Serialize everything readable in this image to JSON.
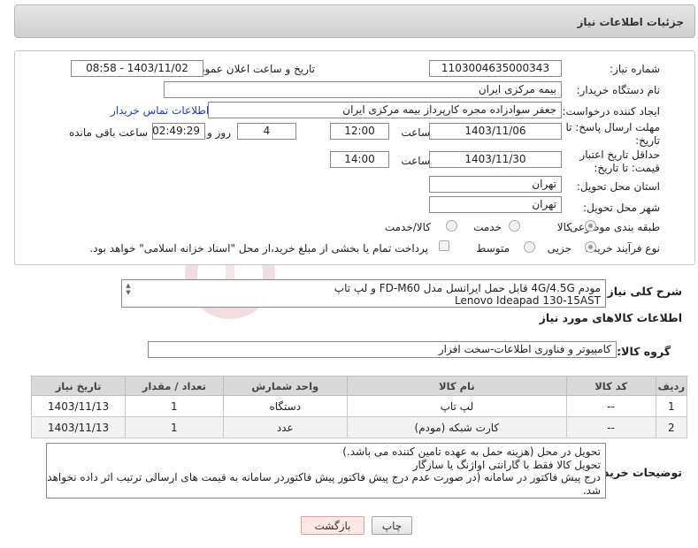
{
  "header": {
    "title": "جزئیات اطلاعات نیاز"
  },
  "form": {
    "need_number_label": "شماره نیاز:",
    "need_number": "1103004635000343",
    "announce_label": "تاریخ و ساعت اعلان عمومی:",
    "announce_value": "1403/11/02 - 08:58",
    "buyer_org_label": "نام دستگاه خریدار:",
    "buyer_org": "بیمه مرکزی ایران",
    "requester_label": "ایجاد کننده درخواست:",
    "requester": "جعفر سوادزاده مجره کارپرداز بیمه مرکزی ایران",
    "contact_link": "اطلاعات تماس خریدار",
    "reply_deadline_label": "مهلت ارسال پاسخ: تا تاریخ:",
    "reply_date": "1403/11/06",
    "time_label": "ساعت",
    "reply_time": "12:00",
    "days_value": "4",
    "days_label": "روز و",
    "remaining_time": "02:49:29",
    "remaining_label": "ساعت باقی مانده",
    "price_validity_label": "حداقل تاریخ اعتبار قیمت: تا تاریخ:",
    "price_date": "1403/11/30",
    "price_time_label": "ساعت",
    "price_time": "14:00",
    "province_label": "استان محل تحویل:",
    "province": "تهران",
    "city_label": "شهر محل تحویل:",
    "city": "تهران",
    "category_label": "طبقه بندی موضوعی:",
    "category_options": [
      "کالا",
      "خدمت",
      "کالا/خدمت"
    ],
    "process_label": "نوع فرآیند خرید :",
    "process_options": [
      "جزیی",
      "متوسط"
    ],
    "payment_note": "پرداخت تمام یا بخشی از مبلغ خرید،از محل \"اسناد خزانه اسلامی\" خواهد بود."
  },
  "summary": {
    "label": "شرح کلی نیاز:",
    "line1": "مودم 4G/4.5G قابل حمل ایرانسل مدل FD-M60 و لپ تاپ",
    "line2": "Lenovo Ideapad 130-15AST"
  },
  "goods": {
    "section_title": "اطلاعات کالاهای مورد نیاز",
    "group_label": "گروه کالا:",
    "group_value": "کامپیوتر و فناوری اطلاعات-سخت افزار"
  },
  "table": {
    "headers": [
      "ردیف",
      "کد کالا",
      "نام کالا",
      "واحد شمارش",
      "تعداد / مقدار",
      "تاریخ نیاز"
    ],
    "rows": [
      [
        "1",
        "--",
        "لپ تاپ",
        "دستگاه",
        "1",
        "1403/11/13"
      ],
      [
        "2",
        "--",
        "کارت شبکه (مودم)",
        "عدد",
        "1",
        "1403/11/13"
      ]
    ]
  },
  "buyer_notes": {
    "label": "توضیحات خریدار:",
    "line1": "تحویل در محل (هزینه حمل به عهده تامین کننده می باشد.)",
    "line2": "تحویل کالا فقط با گارانتی اواژنگ یا سازگار",
    "line3": "درج پیش فاکتور در سامانه (در صورت عدم درج پیش فاکتور پیش فاکتوردر سامانه به قیمت های ارسالی ترتیب اثر داده نخواهد",
    "line4": "شد."
  },
  "buttons": {
    "print": "چاپ",
    "back": "بازگشت"
  },
  "colors": {
    "link": "#1b3cc7",
    "back_button_bg": "#fde7e7",
    "back_button_border": "#d9a0a0",
    "header_bg": "#d8d8d8"
  }
}
